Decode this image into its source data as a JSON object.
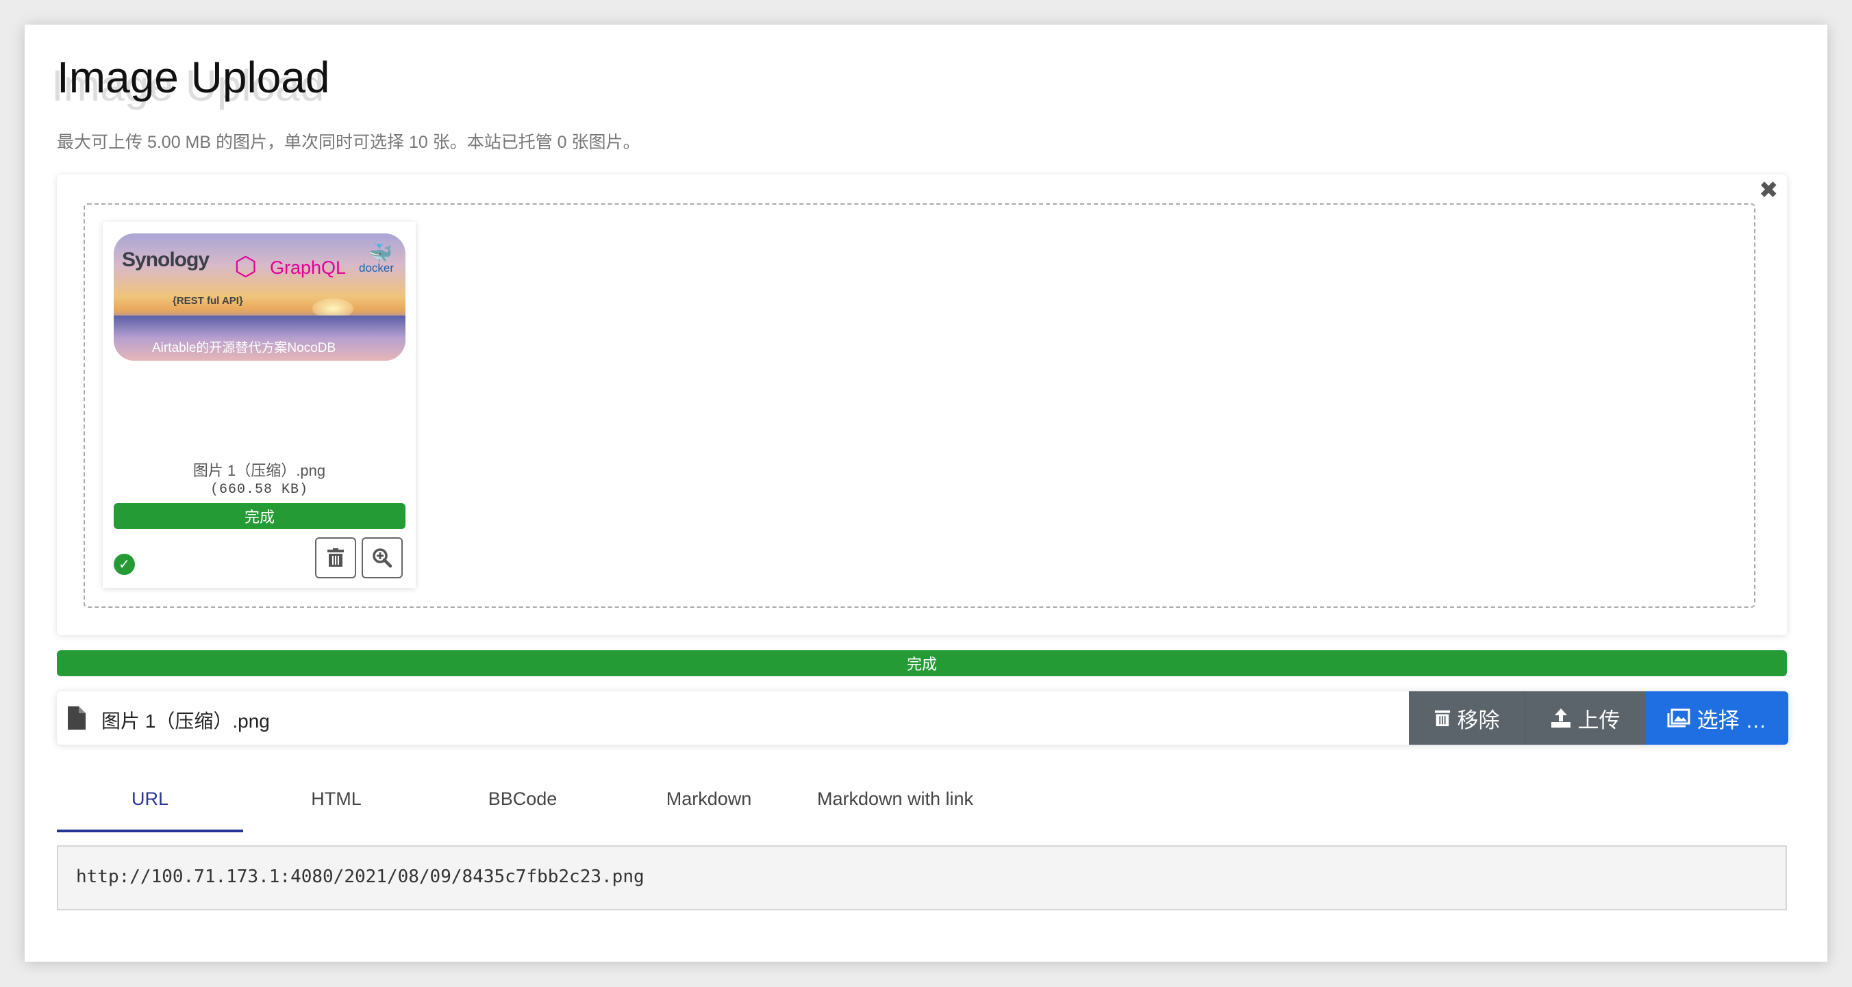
{
  "header": {
    "title": "Image Upload",
    "subtitle": "最大可上传 5.00 MB 的图片，单次同时可选择 10 张。本站已托管 0 张图片。"
  },
  "preview": {
    "image_text": {
      "synology": "Synology",
      "graphql": "GraphQL",
      "docker": "docker",
      "restful": "{REST ful API}",
      "caption": "Airtable的开源替代方案NocoDB"
    },
    "filename": "图片 1（压缩）.png",
    "filesize": "(660.58 KB)",
    "status": "完成",
    "progress": 100
  },
  "overall": {
    "status": "完成",
    "progress": 100
  },
  "filebar": {
    "filename": "图片 1（压缩）.png",
    "remove": "移除",
    "upload": "上传",
    "select": "选择 …"
  },
  "tabs": [
    {
      "label": "URL",
      "active": true
    },
    {
      "label": "HTML"
    },
    {
      "label": "BBCode"
    },
    {
      "label": "Markdown"
    },
    {
      "label": "Markdown with link"
    }
  ],
  "output": {
    "value": "http://100.71.173.1:4080/2021/08/09/8435c7fbb2c23.png"
  },
  "colors": {
    "success": "#259b36",
    "primary": "#1f6fe3",
    "secondary": "#5b636b",
    "tab_active": "#283593"
  }
}
